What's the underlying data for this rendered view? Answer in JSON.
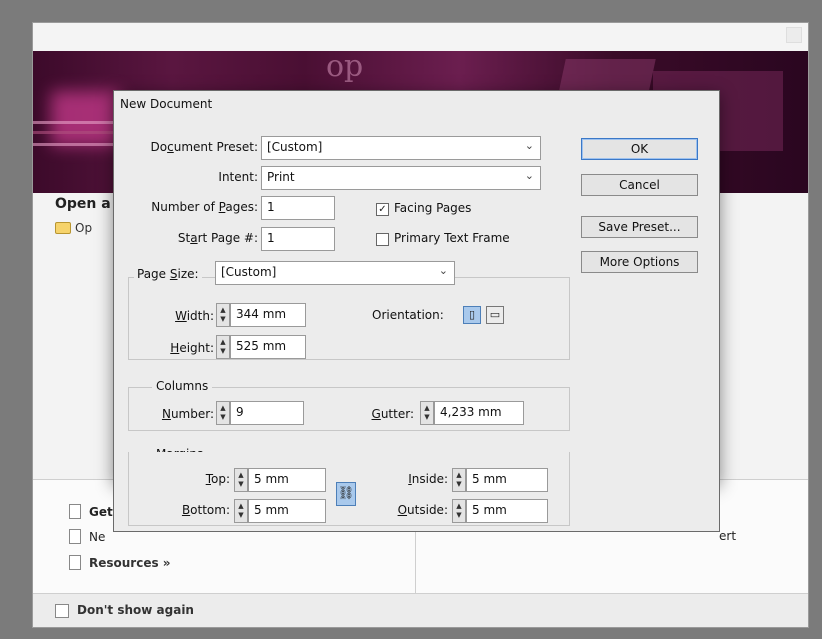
{
  "welcome": {
    "open_heading": "Open a",
    "open_item": "Op",
    "lower_items": [
      "Get",
      "Ne"
    ],
    "resources": "Resources »",
    "right_fragment": "ert",
    "dont_show": "Don't show again"
  },
  "dialog": {
    "title": "New Document",
    "document_preset": {
      "label": "Document Preset:",
      "value": "[Custom]"
    },
    "intent": {
      "label": "Intent:",
      "value": "Print"
    },
    "pages": {
      "label": "Number of Pages:",
      "value": "1"
    },
    "start_page": {
      "label": "Start Page #:",
      "value": "1"
    },
    "facing_pages": {
      "label": "Facing Pages",
      "checked": true
    },
    "primary_text_frame": {
      "label": "Primary Text Frame",
      "checked": false
    },
    "page_size": {
      "label": "Page Size:",
      "value": "[Custom]"
    },
    "width": {
      "label": "Width:",
      "value": "344 mm"
    },
    "height": {
      "label": "Height:",
      "value": "525 mm"
    },
    "orientation": {
      "label": "Orientation:",
      "selected": "portrait"
    },
    "columns": {
      "group": "Columns",
      "number_label": "Number:",
      "number_value": "9",
      "gutter_label": "Gutter:",
      "gutter_value": "4,233 mm"
    },
    "margins": {
      "group": "Margins",
      "top_label": "Top:",
      "top_value": "5 mm",
      "bottom_label": "Bottom:",
      "bottom_value": "5 mm",
      "inside_label": "Inside:",
      "inside_value": "5 mm",
      "outside_label": "Outside:",
      "outside_value": "5 mm"
    },
    "buttons": {
      "ok": "OK",
      "cancel": "Cancel",
      "save_preset": "Save Preset...",
      "more_options": "More Options"
    }
  }
}
